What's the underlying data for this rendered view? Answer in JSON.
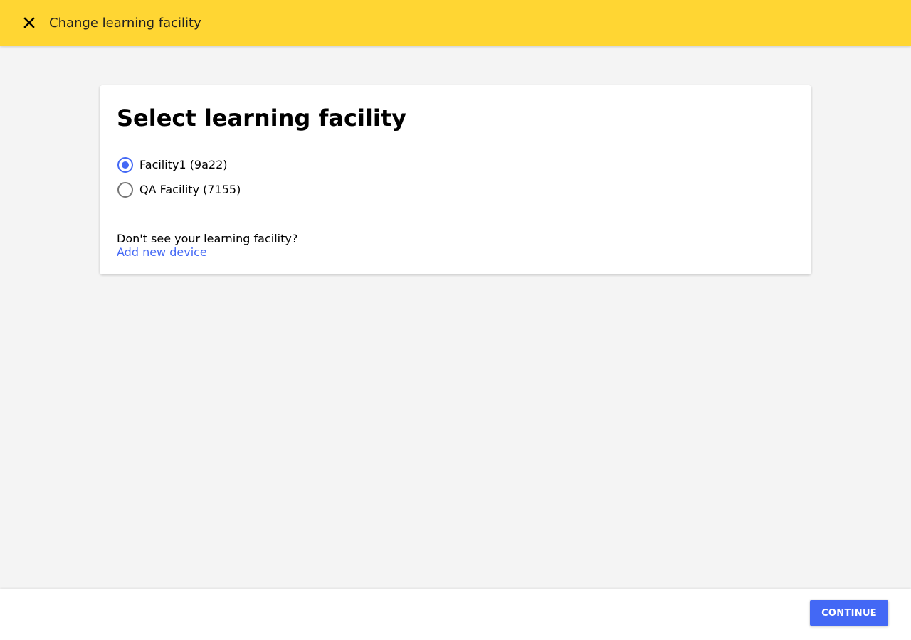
{
  "app_bar": {
    "title": "Change learning facility",
    "close_icon": "close-icon",
    "background_color": "#ffd633"
  },
  "card": {
    "title": "Select learning facility",
    "facilities": [
      {
        "label": "Facility1 (9a22)",
        "selected": true
      },
      {
        "label": "QA Facility (7155)",
        "selected": false
      }
    ],
    "help_text": "Don't see your learning facility?",
    "add_link": "Add new device"
  },
  "footer": {
    "continue_label": "Continue"
  },
  "colors": {
    "accent": "#4368f5",
    "page_background": "#f4f4f4"
  }
}
